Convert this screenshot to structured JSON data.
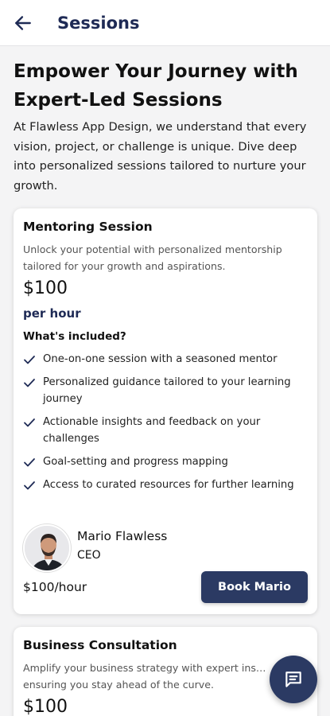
{
  "header": {
    "title": "Sessions",
    "back_icon": "arrow-left-icon"
  },
  "hero": {
    "title": "Empower Your Journey with Expert-Led Sessions",
    "description": "At Flawless App Design, we understand that every vision, project, or challenge is unique. Dive deep into personalized sessions tailored to nurture your growth."
  },
  "sessions": [
    {
      "title": "Mentoring Session",
      "description": "Unlock your potential with personalized mentorship tailored for your growth and aspirations.",
      "price": "$100",
      "unit": "per hour",
      "included_title": "What's included?",
      "features": [
        "One-on-one session with a seasoned mentor",
        "Personalized guidance tailored to your learning journey",
        "Actionable insights and feedback on your challenges",
        "Goal-setting and progress mapping",
        "Access to curated resources for further learning"
      ],
      "mentor": {
        "name": "Mario Flawless",
        "role": "CEO"
      },
      "rate": "$100/hour",
      "book_label": "Book Mario"
    },
    {
      "title": "Business Consultation",
      "description": "Amplify your business strategy with expert ins… ensuring you stay ahead of the curve.",
      "price": "$100"
    }
  ],
  "colors": {
    "primary": "#2b3a63",
    "title": "#1e2a55",
    "background": "#f4f4f5"
  },
  "chat_icon": "chat-icon"
}
